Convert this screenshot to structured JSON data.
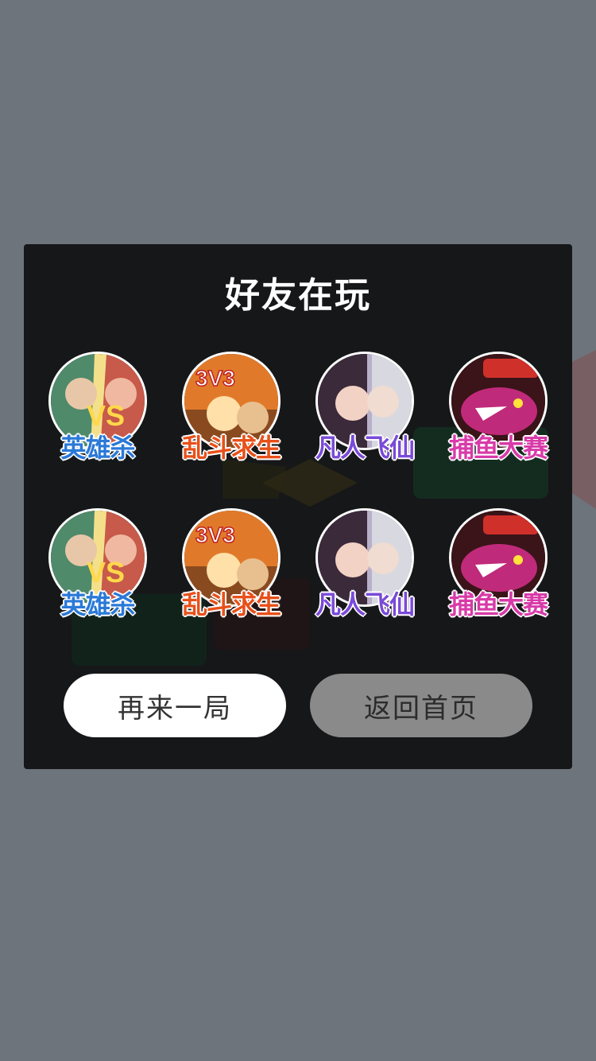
{
  "dialog": {
    "title": "好友在玩",
    "games": [
      {
        "label": "英雄杀",
        "icon": "hero-vs-art-icon"
      },
      {
        "label": "乱斗求生",
        "icon": "brawl-3v3-art-icon"
      },
      {
        "label": "凡人飞仙",
        "icon": "immortal-couple-art-icon"
      },
      {
        "label": "捕鱼大赛",
        "icon": "fish-shark-art-icon"
      },
      {
        "label": "英雄杀",
        "icon": "hero-vs-art-icon"
      },
      {
        "label": "乱斗求生",
        "icon": "brawl-3v3-art-icon"
      },
      {
        "label": "凡人飞仙",
        "icon": "immortal-couple-art-icon"
      },
      {
        "label": "捕鱼大赛",
        "icon": "fish-shark-art-icon"
      }
    ],
    "buttons": {
      "play_again": "再来一局",
      "back_home": "返回首页"
    }
  },
  "colors": {
    "overlay": "#6e747b",
    "panel": "#161719",
    "primary_button": "#ffffff",
    "secondary_button": "#8a8a8a"
  }
}
